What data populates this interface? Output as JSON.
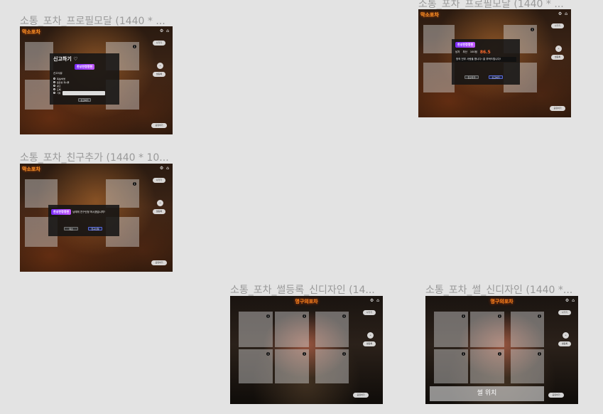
{
  "frames": {
    "profile_report": {
      "title": "소통_포차_프로필모달 (1440 * ..."
    },
    "profile_modal": {
      "title": "소통_포차_프로필모달 (1440 * ..."
    },
    "add_friend": {
      "title": "소통_포차_친구추가 (1440 * 10..."
    },
    "ssul_register": {
      "title": "소통_포차_썰등록_신디자인 (14..."
    },
    "ssul": {
      "title": "소통_포차_썰_신디자인 (1440 *..."
    }
  },
  "app": {
    "logo": "막소포차",
    "sign": "명구의포차",
    "icons": "⚙ ⌂"
  },
  "sidebar": {
    "btn_top": "나가기",
    "btn_mid": "+",
    "btn_mid2": "썰등록",
    "btn_bottom": "공유하기"
  },
  "report_modal": {
    "title": "신고하기 ♡",
    "user": "한성한정정현",
    "section_label": "신고사유",
    "options": [
      "욕설/비방",
      "음란성 게시물",
      "광고",
      "도배",
      "기타"
    ],
    "submit": "신고하기"
  },
  "profile_modal": {
    "user": "한성한정정현",
    "stats": [
      "남자",
      "부산",
      "100점"
    ],
    "score": "86.5",
    "message": "방의 전부 사랑을 합니다! 잘 부탁드립니다!",
    "btn_left": "친구추가",
    "btn_right": "신고하기"
  },
  "friend_modal": {
    "user": "한성한정정현",
    "message": "님에게 친구신청 하시겠습니까?",
    "btn_cancel": "취소",
    "btn_confirm": "친구신청"
  },
  "ssul_bar": {
    "label": "썰 위치"
  }
}
